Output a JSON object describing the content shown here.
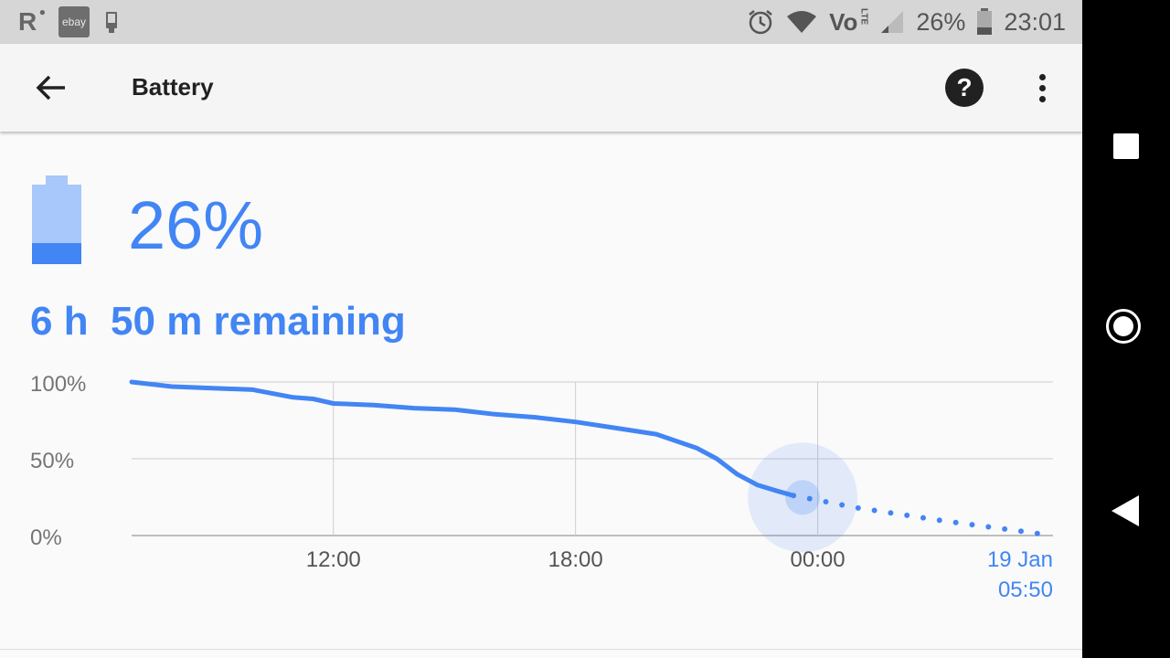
{
  "status_bar": {
    "icons_left": [
      "r-icon",
      "ebay-icon",
      "device-icon"
    ],
    "r_label": "R",
    "ebay_label": "ebay",
    "icons_right": [
      "alarm-icon",
      "wifi-icon",
      "volte-icon",
      "signal-icon",
      "battery-icon"
    ],
    "volte_label": "Vo",
    "lte_label": "LTE",
    "battery_percent": "26%",
    "time": "23:01"
  },
  "app_bar": {
    "title": "Battery",
    "back_icon": "arrow-back-icon",
    "help_icon": "help-icon",
    "help_label": "?",
    "more_icon": "more-vert-icon"
  },
  "battery": {
    "level": 0.26,
    "percent_label": "26%",
    "remaining_label": "6 h  50 m remaining"
  },
  "chart_data": {
    "type": "line",
    "title": "",
    "xlabel": "",
    "ylabel": "",
    "y_tick_labels": [
      "100%",
      "50%",
      "0%"
    ],
    "x_tick_labels": [
      "12:00",
      "18:00",
      "00:00"
    ],
    "x_end_label_lines": [
      "19 Jan",
      "05:50"
    ],
    "ylim": [
      0,
      100
    ],
    "x_unit": "hours (relative to 12:00 = 12)",
    "xlim": [
      7.0,
      29.83
    ],
    "grid": true,
    "series": [
      {
        "style": "solid",
        "x": [
          7.0,
          8.0,
          9.0,
          10.0,
          11.0,
          11.5,
          12.0,
          13.0,
          14.0,
          15.0,
          16.0,
          17.0,
          18.0,
          19.0,
          20.0,
          21.0,
          21.5,
          22.0,
          22.5,
          23.0,
          23.4
        ],
        "values": [
          100,
          97,
          96,
          95,
          90,
          89,
          86,
          85,
          83,
          82,
          79,
          77,
          74,
          70,
          66,
          57,
          50,
          40,
          33,
          29,
          26
        ]
      },
      {
        "style": "dotted",
        "x": [
          23.4,
          25,
          27,
          29.83
        ],
        "values": [
          26,
          18,
          10,
          0
        ]
      }
    ],
    "highlight_point": {
      "x": 23.4,
      "value": 26
    },
    "colors": {
      "line": "#4285f4",
      "grid": "#cccccc",
      "end_label": "#4285f4",
      "tick": "#757575"
    }
  },
  "nav_bar": {
    "buttons": [
      "recents-icon",
      "home-icon",
      "back-triangle-icon"
    ]
  },
  "colors": {
    "accent": "#4285f4",
    "battery_light": "#a8c7fa",
    "status_bar_bg": "#d6d6d6",
    "app_bar_bg": "#f5f5f5"
  }
}
